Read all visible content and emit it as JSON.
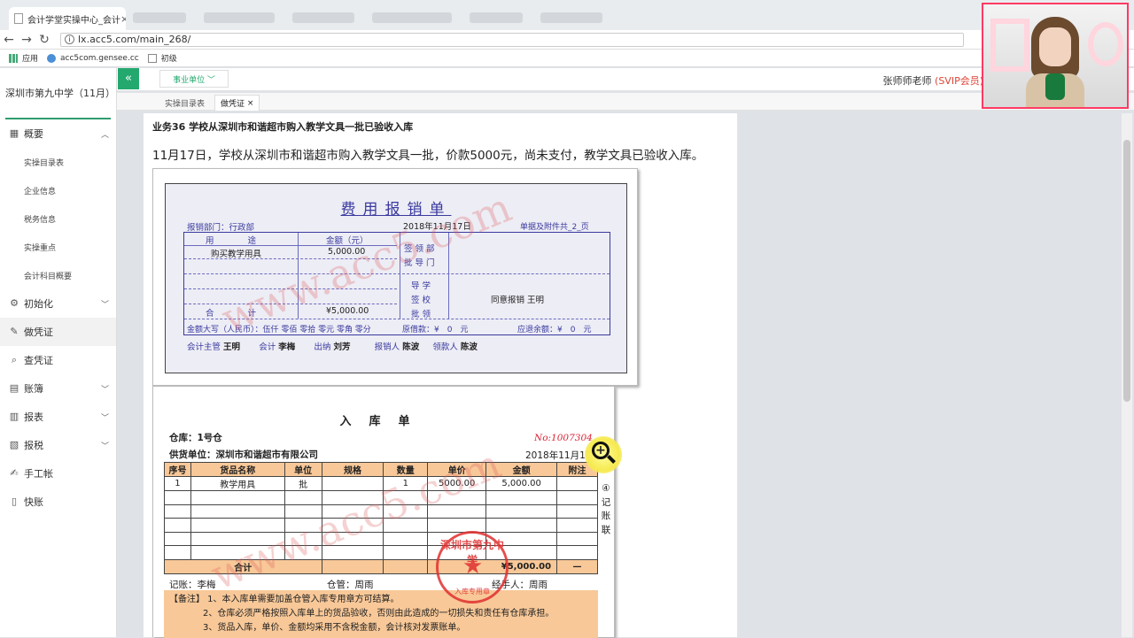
{
  "browser": {
    "tab_title": "会计学堂实操中心_会计",
    "url": "lx.acc5.com/main_268/",
    "bookmarks": [
      "应用",
      "acc5com.gensee.cc",
      "初级"
    ]
  },
  "sidebar": {
    "school": "深圳市第九中学（11月）",
    "items": [
      {
        "label": "概要",
        "icon": "grid-icon",
        "chev": "︿"
      },
      {
        "label": "实操目录表",
        "sub": true
      },
      {
        "label": "企业信息",
        "sub": true
      },
      {
        "label": "税务信息",
        "sub": true
      },
      {
        "label": "实操重点",
        "sub": true
      },
      {
        "label": "会计科目概要",
        "sub": true
      },
      {
        "label": "初始化",
        "icon": "gear-icon",
        "chev": "﹀"
      },
      {
        "label": "做凭证",
        "icon": "pen-icon",
        "active": true
      },
      {
        "label": "查凭证",
        "icon": "search-icon"
      },
      {
        "label": "账簿",
        "icon": "book-icon",
        "chev": "﹀"
      },
      {
        "label": "报表",
        "icon": "report-icon",
        "chev": "﹀"
      },
      {
        "label": "报税",
        "icon": "tax-icon",
        "chev": "﹀"
      },
      {
        "label": "手工帐",
        "icon": "hand-icon"
      },
      {
        "label": "快账",
        "icon": "doc-icon"
      }
    ]
  },
  "topbar": {
    "collapse": "«",
    "unit": "事业单位 ﹀",
    "teacher": "张师师老师",
    "vip": "(SVIP会员)"
  },
  "tabs": {
    "t1": "实操目录表",
    "t2": "做凭证",
    "close": "×"
  },
  "main": {
    "business": "业务36 学校从深圳市和谐超市购入教学文具一批已验收入库",
    "description": "11月17日，学校从深圳市和谐超市购入教学文具一批，价款5000元，尚未支付，教学文具已验收入库。"
  },
  "expense": {
    "title": "费用报销单",
    "dept": "报销部门：行政部",
    "date": "2018年11月17日",
    "attach": "单据及附件共_2_页",
    "h_use": "用　　　　途",
    "h_amt": "金额（元）",
    "use1": "购买教学用具",
    "amt1": "5,000.00",
    "total_lbl": "合　　　　计",
    "total": "¥5,000.00",
    "approve1": "签 领 部",
    "approve2": "批 导 门",
    "guide1": "导 学",
    "guide2": "签 校",
    "guide3": "批 领",
    "approve_text": "同意报销 王明",
    "caps": "金额大写（人民币）：伍仟 零佰 零拾 零元 零角 零分",
    "borrow": "原借款：¥　0　元",
    "balance": "应退余额：¥　0　元",
    "f1": "会计主管",
    "v1": "王明",
    "f2": "会计",
    "v2": "李梅",
    "f3": "出纳",
    "v3": "刘芳",
    "f4": "报销人",
    "v4": "陈波",
    "f5": "领款人",
    "v5": "陈波"
  },
  "warehouse": {
    "title": "入库单",
    "store": "仓库：1号仓",
    "no": "No:1007304",
    "supplier": "供货单位：深圳市和谐超市有限公司",
    "date": "2018年11月17日",
    "headers": [
      "序号",
      "货品名称",
      "单位",
      "规格",
      "数量",
      "单价",
      "金额",
      "附注"
    ],
    "rows": [
      [
        "1",
        "教学用具",
        "批",
        "",
        "1",
        "5000.00",
        "5,000.00",
        ""
      ],
      [
        "",
        "",
        "",
        "",
        "",
        "",
        "",
        ""
      ],
      [
        "",
        "",
        "",
        "",
        "",
        "",
        "",
        ""
      ],
      [
        "",
        "",
        "",
        "",
        "",
        "",
        "",
        ""
      ],
      [
        "",
        "",
        "",
        "",
        "",
        "",
        "",
        ""
      ],
      [
        "",
        "",
        "",
        "",
        "",
        "",
        "",
        ""
      ]
    ],
    "total_label": "合计",
    "total": "¥5,000.00",
    "total_note": "—",
    "keeper": "记账：李梅",
    "manager": "仓管：周雨",
    "handler": "经手人：周雨",
    "notes": [
      "【备注】  1、本入库单需要加盖仓管入库专用章方可结算。",
      "2、仓库必须严格按照入库单上的货品验收，否则由此造成的一切损失和责任有仓库承担。",
      "3、货品入库，单价、金额均采用不含税金额，会计核对发票账单。"
    ],
    "side": [
      "④",
      "记",
      "账",
      "联"
    ],
    "stamp_top": "深圳市第九中学",
    "stamp_bottom": "入库专用章"
  },
  "watermark": "www.acc5.com"
}
